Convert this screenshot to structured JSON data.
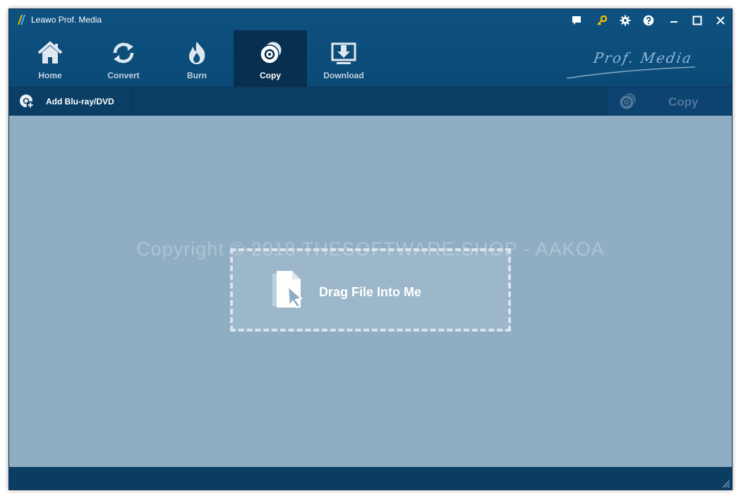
{
  "window": {
    "title": "Leawo Prof. Media"
  },
  "title_controls": [
    {
      "name": "feedback-icon"
    },
    {
      "name": "key-icon"
    },
    {
      "name": "gear-icon"
    },
    {
      "name": "help-icon"
    },
    {
      "name": "minimize-icon"
    },
    {
      "name": "maximize-icon"
    },
    {
      "name": "close-icon"
    }
  ],
  "nav": {
    "items": [
      {
        "label": "Home",
        "icon": "home-icon"
      },
      {
        "label": "Convert",
        "icon": "convert-icon"
      },
      {
        "label": "Burn",
        "icon": "burn-icon"
      },
      {
        "label": "Copy",
        "icon": "copy-disc-icon",
        "active": true
      },
      {
        "label": "Download",
        "icon": "download-icon"
      }
    ]
  },
  "brand": {
    "text": "Prof. Media"
  },
  "toolbar": {
    "add_label": "Add Blu-ray/DVD",
    "copy_label": "Copy"
  },
  "main": {
    "watermark": "Copyright © 2018 THESOFTWARE.SHOP - AAKOA",
    "drop_label": "Drag File Into Me"
  },
  "colors": {
    "accent_key": "#f5c400",
    "topbar": "#0e5180",
    "active_tab": "#072f4f",
    "content_bg": "#8fadc3"
  }
}
